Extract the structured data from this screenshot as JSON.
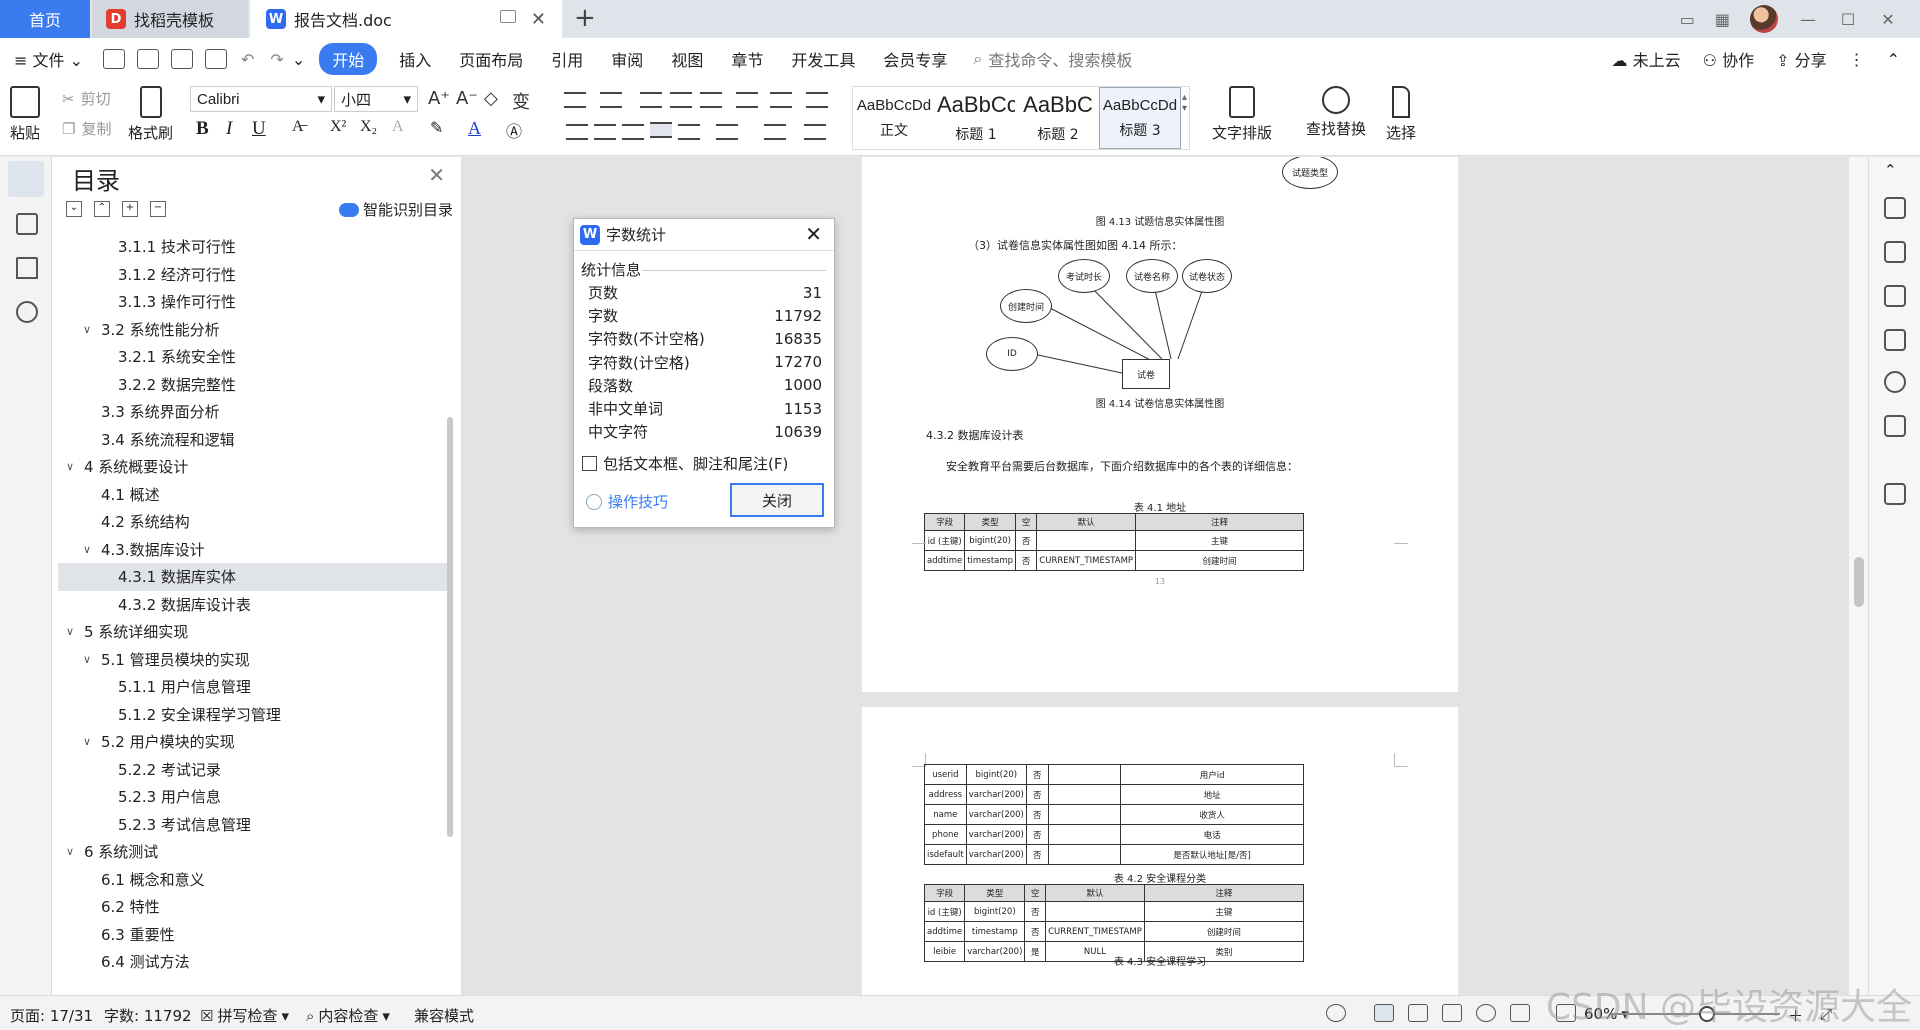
{
  "titlebar": {
    "tabs": [
      {
        "label": "首页"
      },
      {
        "label": "找稻壳模板",
        "badge": "D"
      },
      {
        "label": "报告文档.doc",
        "badge": "W"
      }
    ],
    "add": "+",
    "window_controls": [
      "—",
      "☐",
      "✕"
    ]
  },
  "menu": {
    "file": "文件",
    "items": [
      "开始",
      "插入",
      "页面布局",
      "引用",
      "审阅",
      "视图",
      "章节",
      "开发工具",
      "会员专享"
    ],
    "search_placeholder": "查找命令、搜索模板",
    "right": [
      "未上云",
      "协作",
      "分享"
    ]
  },
  "ribbon": {
    "paste": "粘贴",
    "cut": "剪切",
    "copy": "复制",
    "format_painter": "格式刷",
    "font_name": "Calibri",
    "font_size": "小四",
    "bold": "B",
    "italic": "I",
    "underline": "U",
    "styles": [
      {
        "sample": "AaBbCcDd",
        "label": "正文"
      },
      {
        "sample": "AaBbCc",
        "label": "标题 1"
      },
      {
        "sample": "AaBbC",
        "label": "标题 2"
      },
      {
        "sample": "AaBbCcDd",
        "label": "标题 3"
      }
    ],
    "text_layout": "文字排版",
    "find_replace": "查找替换",
    "select": "选择"
  },
  "toc": {
    "title": "目录",
    "smart": "智能识别目录",
    "items": [
      {
        "text": "3.1.1 技术可行性",
        "level": 3
      },
      {
        "text": "3.1.2 经济可行性",
        "level": 3
      },
      {
        "text": "3.1.3 操作可行性",
        "level": 3
      },
      {
        "text": "3.2 系统性能分析",
        "level": 2,
        "expanded": true
      },
      {
        "text": "3.2.1  系统安全性",
        "level": 3
      },
      {
        "text": "3.2.2  数据完整性",
        "level": 3
      },
      {
        "text": "3.3 系统界面分析",
        "level": 2
      },
      {
        "text": "3.4 系统流程和逻辑",
        "level": 2
      },
      {
        "text": "4 系统概要设计",
        "level": 1,
        "expanded": true
      },
      {
        "text": "4.1 概述",
        "level": 2
      },
      {
        "text": "4.2 系统结构",
        "level": 2
      },
      {
        "text": "4.3.数据库设计",
        "level": 2,
        "expanded": true
      },
      {
        "text": "4.3.1 数据库实体",
        "level": 3,
        "selected": true
      },
      {
        "text": "4.3.2 数据库设计表",
        "level": 3
      },
      {
        "text": "5 系统详细实现",
        "level": 1,
        "expanded": true
      },
      {
        "text": "5.1  管理员模块的实现",
        "level": 2,
        "expanded": true
      },
      {
        "text": "5.1.1  用户信息管理",
        "level": 3
      },
      {
        "text": "5.1.2  安全课程学习管理",
        "level": 3
      },
      {
        "text": "5.2  用户模块的实现",
        "level": 2,
        "expanded": true
      },
      {
        "text": "5.2.2  考试记录",
        "level": 3
      },
      {
        "text": "5.2.3  用户信息",
        "level": 3
      },
      {
        "text": "5.2.3  考试信息管理",
        "level": 3
      },
      {
        "text": "6 系统测试",
        "level": 1,
        "expanded": true
      },
      {
        "text": "6.1 概念和意义",
        "level": 2
      },
      {
        "text": "6.2 特性",
        "level": 2
      },
      {
        "text": "6.3 重要性",
        "level": 2
      },
      {
        "text": "6.4 测试方法",
        "level": 2
      }
    ]
  },
  "document": {
    "top_node": "试题类型",
    "fig413": "图 4.13   试题信息实体属性图",
    "para_fig414": "（3）试卷信息实体属性图如图 4.14 所示：",
    "er_nodes": {
      "time": "考试时长",
      "name": "试卷名称",
      "status": "试卷状态",
      "created": "创建时间",
      "id": "ID",
      "entity": "试卷"
    },
    "fig414": "图 4.14  试卷信息实体属性图",
    "heading_432": "4.3.2 数据库设计表",
    "intro": "安全教育平台需要后台数据库，下面介绍数据库中的各个表的详细信息：",
    "table41_caption": "表 4.1  地址",
    "headers": [
      "字段",
      "类型",
      "空",
      "默认",
      "注释"
    ],
    "table41_rows": [
      [
        "id (主键)",
        "bigint(20)",
        "否",
        "",
        "主键"
      ],
      [
        "addtime",
        "timestamp",
        "否",
        "CURRENT_TIMESTAMP",
        "创建时间"
      ]
    ],
    "page_number": "13",
    "table41_cont_rows": [
      [
        "userid",
        "bigint(20)",
        "否",
        "",
        "用户id"
      ],
      [
        "address",
        "varchar(200)",
        "否",
        "",
        "地址"
      ],
      [
        "name",
        "varchar(200)",
        "否",
        "",
        "收货人"
      ],
      [
        "phone",
        "varchar(200)",
        "否",
        "",
        "电话"
      ],
      [
        "isdefault",
        "varchar(200)",
        "否",
        "",
        "是否默认地址[是/否]"
      ]
    ],
    "table42_caption": "表 4.2  安全课程分类",
    "table42_rows": [
      [
        "id (主键)",
        "bigint(20)",
        "否",
        "",
        "主键"
      ],
      [
        "addtime",
        "timestamp",
        "否",
        "CURRENT_TIMESTAMP",
        "创建时间"
      ],
      [
        "leibie",
        "varchar(200)",
        "是",
        "NULL",
        "类别"
      ]
    ],
    "table43_caption": "表 4.3  安全课程学习"
  },
  "dialog": {
    "title": "字数统计",
    "section": "统计信息",
    "stats": [
      {
        "label": "页数",
        "value": "31"
      },
      {
        "label": "字数",
        "value": "11792"
      },
      {
        "label": "字符数(不计空格)",
        "value": "16835"
      },
      {
        "label": "字符数(计空格)",
        "value": "17270"
      },
      {
        "label": "段落数",
        "value": "1000"
      },
      {
        "label": "非中文单词",
        "value": "1153"
      },
      {
        "label": "中文字符",
        "value": "10639"
      }
    ],
    "checkbox_label": "包括文本框、脚注和尾注(F)",
    "tips": "操作技巧",
    "close": "关闭"
  },
  "status": {
    "page": "页面: 17/31",
    "words": "字数: 11792",
    "spell": "拼写检查",
    "content_check": "内容检查",
    "compat": "兼容模式",
    "zoom": "60%",
    "zoom_fraction": 0.57,
    "watermark": "CSDN @毕设资源大全"
  },
  "colors": {
    "accent": "#3a7cf0",
    "tab_bar": "#dfe3ea",
    "canvas": "#e3e3e3"
  }
}
